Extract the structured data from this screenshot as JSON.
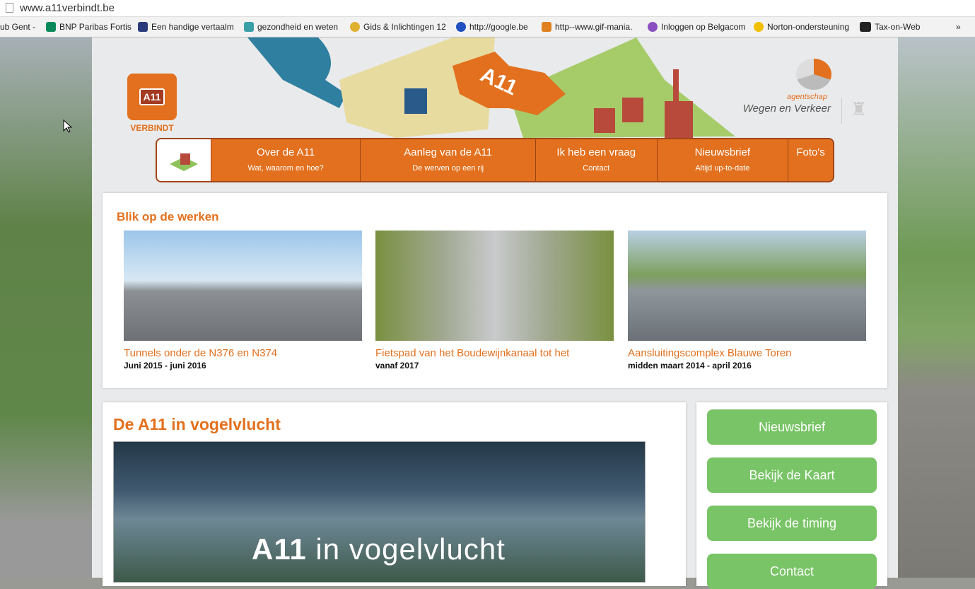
{
  "browser": {
    "url": "www.a11verbindt.be",
    "bookmarks": [
      {
        "label": "ub Gent -",
        "color": "#ffffff"
      },
      {
        "label": "BNP Paribas Fortis",
        "color": "#0a8a5a"
      },
      {
        "label": "Een handige vertaalm",
        "color": "#2b3a7a"
      },
      {
        "label": "gezondheid en weten",
        "color": "#3aa0a8"
      },
      {
        "label": "Gids & Inlichtingen 12",
        "color": "#e0b030"
      },
      {
        "label": "http://google.be",
        "color": "#2050c0"
      },
      {
        "label": "http--www.gif-mania.",
        "color": "#e08020"
      },
      {
        "label": "Inloggen op Belgacom",
        "color": "#8a50c0"
      },
      {
        "label": "Norton-ondersteuning",
        "color": "#f0c000"
      },
      {
        "label": "Tax-on-Web",
        "color": "#222222"
      }
    ],
    "overflow": "»"
  },
  "header": {
    "logo_text": "A11",
    "logo_subtitle": "VERBINDT",
    "illus_text": "A11",
    "agency_small": "agentschap",
    "agency_name": "Wegen en Verkeer"
  },
  "nav": [
    {
      "title": "Over de A11",
      "sub": "Wat, waarom en hoe?"
    },
    {
      "title": "Aanleg van de A11",
      "sub": "De werven op een rij"
    },
    {
      "title": "Ik heb een vraag",
      "sub": "Contact"
    },
    {
      "title": "Nieuwsbrief",
      "sub": "Altijd up-to-date"
    },
    {
      "title": "Foto's",
      "sub": ""
    }
  ],
  "works": {
    "title": "Blik op de werken",
    "items": [
      {
        "caption": "Tunnels onder de N376 en N374",
        "date": "Juni 2015 - juni 2016"
      },
      {
        "caption": "Fietspad van het Boudewijnkanaal tot het",
        "date": "vanaf 2017"
      },
      {
        "caption": "Aansluitingscomplex Blauwe Toren",
        "date": "midden maart 2014 - april 2016"
      }
    ]
  },
  "overview": {
    "title": "De A11 in vogelvlucht",
    "video_bold": "A11",
    "video_rest": " in vogelvlucht"
  },
  "sidebar": {
    "buttons": [
      "Nieuwsbrief",
      "Bekijk de Kaart",
      "Bekijk de timing",
      "Contact"
    ]
  },
  "colors": {
    "accent": "#e2701e",
    "green": "#78c466"
  }
}
